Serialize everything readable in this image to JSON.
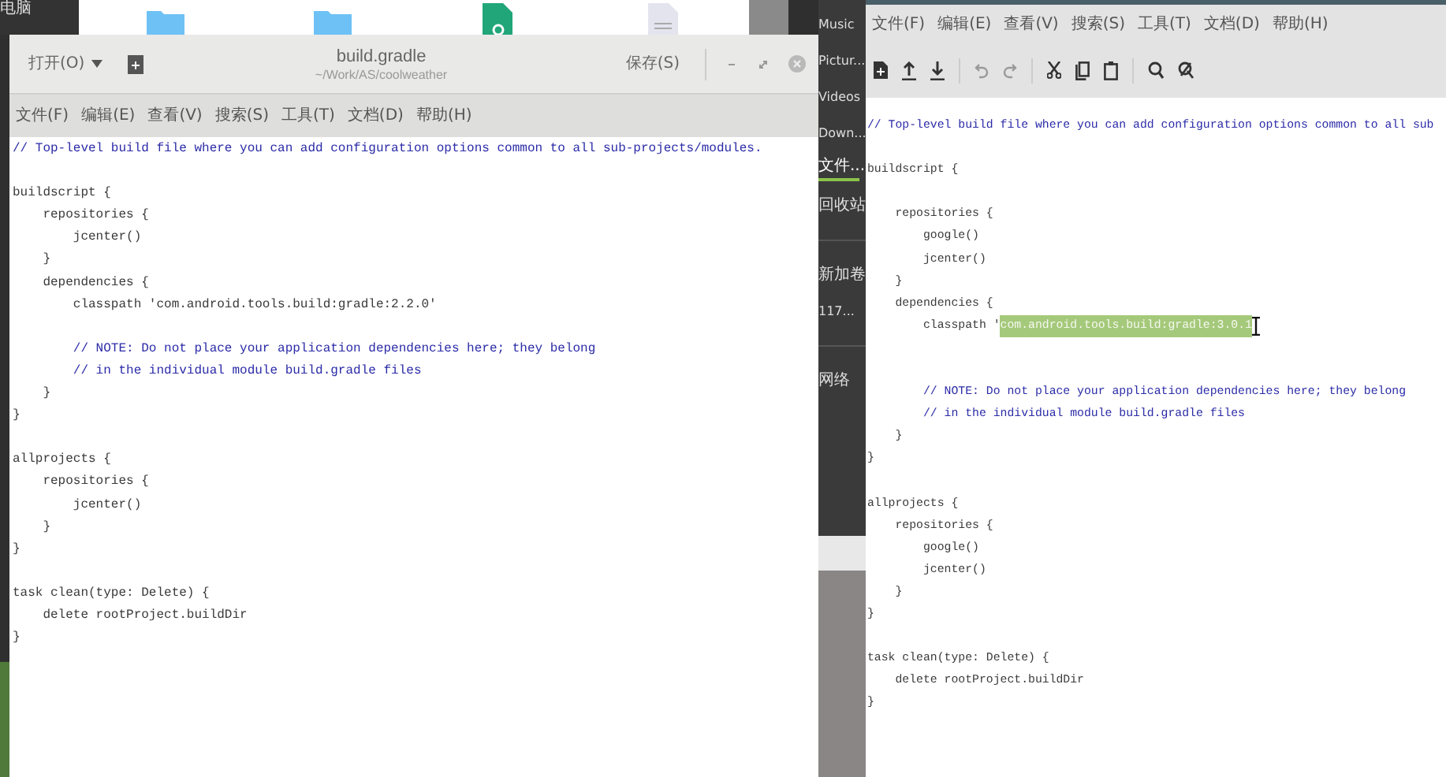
{
  "desktop": {
    "computer_label": "电脑",
    "sidebar_sections": [
      [
        {
          "label": "Music",
          "selected": false
        },
        {
          "label": "Pictur...",
          "selected": false
        },
        {
          "label": "Videos",
          "selected": false
        },
        {
          "label": "Down...",
          "selected": false
        },
        {
          "label": "文件...",
          "selected": true
        },
        {
          "label": "回收站",
          "selected": false
        }
      ],
      [
        {
          "label": "新加卷",
          "selected": false
        },
        {
          "label": "117...",
          "selected": false
        }
      ],
      [
        {
          "label": "网络",
          "selected": false
        }
      ]
    ]
  },
  "left_editor": {
    "open_button": "打开(O)",
    "title": "build.gradle",
    "path": "~/Work/AS/coolweather",
    "save_button": "保存(S)",
    "menu": [
      "文件(F)",
      "编辑(E)",
      "查看(V)",
      "搜索(S)",
      "工具(T)",
      "文档(D)",
      "帮助(H)"
    ],
    "lines": [
      {
        "kind": "comment",
        "text": "// Top-level build file where you can add configuration options common to all sub-projects/modules."
      },
      {
        "kind": "blank"
      },
      {
        "kind": "code",
        "text": "buildscript {"
      },
      {
        "kind": "code",
        "text": "    repositories {"
      },
      {
        "kind": "code",
        "text": "        jcenter()"
      },
      {
        "kind": "code",
        "text": "    }"
      },
      {
        "kind": "code",
        "text": "    dependencies {"
      },
      {
        "kind": "code",
        "text": "        classpath 'com.android.tools.build:gradle:2.2.0'"
      },
      {
        "kind": "blank"
      },
      {
        "kind": "comment",
        "text": "        // NOTE: Do not place your application dependencies here; they belong"
      },
      {
        "kind": "comment",
        "text": "        // in the individual module build.gradle files"
      },
      {
        "kind": "code",
        "text": "    }"
      },
      {
        "kind": "code",
        "text": "}"
      },
      {
        "kind": "blank"
      },
      {
        "kind": "code",
        "text": "allprojects {"
      },
      {
        "kind": "code",
        "text": "    repositories {"
      },
      {
        "kind": "code",
        "text": "        jcenter()"
      },
      {
        "kind": "code",
        "text": "    }"
      },
      {
        "kind": "code",
        "text": "}"
      },
      {
        "kind": "blank"
      },
      {
        "kind": "code",
        "text": "task clean(type: Delete) {"
      },
      {
        "kind": "code",
        "text": "    delete rootProject.buildDir"
      },
      {
        "kind": "code",
        "text": "}"
      }
    ]
  },
  "right_editor": {
    "menu": [
      "文件(F)",
      "编辑(E)",
      "查看(V)",
      "搜索(S)",
      "工具(T)",
      "文档(D)",
      "帮助(H)"
    ],
    "lines": [
      {
        "kind": "comment",
        "text": "// Top-level build file where you can add configuration options common to all sub"
      },
      {
        "kind": "blank"
      },
      {
        "kind": "code",
        "text": "buildscript {"
      },
      {
        "kind": "blank"
      },
      {
        "kind": "code",
        "text": "    repositories {"
      },
      {
        "kind": "code",
        "text": "        google()"
      },
      {
        "kind": "code",
        "text": "        jcenter()"
      },
      {
        "kind": "code",
        "text": "    }"
      },
      {
        "kind": "code",
        "text": "    dependencies {"
      },
      {
        "kind": "code",
        "text": "        classpath '",
        "selection": "com.android.tools.build:gradle:3.0.1",
        "cursor": true
      },
      {
        "kind": "blank"
      },
      {
        "kind": "blank"
      },
      {
        "kind": "comment",
        "text": "        // NOTE: Do not place your application dependencies here; they belong"
      },
      {
        "kind": "comment",
        "text": "        // in the individual module build.gradle files"
      },
      {
        "kind": "code",
        "text": "    }"
      },
      {
        "kind": "code",
        "text": "}"
      },
      {
        "kind": "blank"
      },
      {
        "kind": "code",
        "text": "allprojects {"
      },
      {
        "kind": "code",
        "text": "    repositories {"
      },
      {
        "kind": "code",
        "text": "        google()"
      },
      {
        "kind": "code",
        "text": "        jcenter()"
      },
      {
        "kind": "code",
        "text": "    }"
      },
      {
        "kind": "code",
        "text": "}"
      },
      {
        "kind": "blank"
      },
      {
        "kind": "code",
        "text": "task clean(type: Delete) {"
      },
      {
        "kind": "code",
        "text": "    delete rootProject.buildDir"
      },
      {
        "kind": "code",
        "text": "}"
      }
    ]
  }
}
